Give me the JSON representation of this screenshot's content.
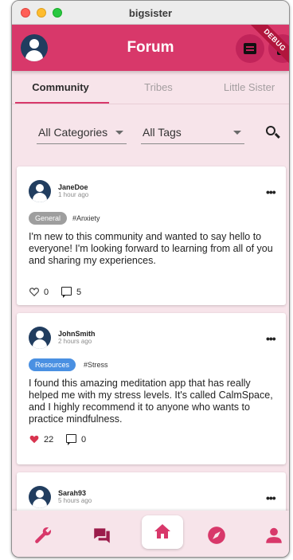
{
  "window": {
    "title": "bigsister"
  },
  "appbar": {
    "title": "Forum",
    "debug_banner": "DEBUG"
  },
  "tabs": [
    {
      "label": "Community",
      "active": true
    },
    {
      "label": "Tribes",
      "active": false
    },
    {
      "label": "Little Sister",
      "active": false
    }
  ],
  "filters": {
    "category": "All Categories",
    "tags": "All Tags"
  },
  "posts": [
    {
      "author": "JaneDoe",
      "time": "1 hour ago",
      "category": "General",
      "category_color": "#9e9e9e",
      "tag": "#Anxiety",
      "content": "I'm new to this community and wanted to say hello to everyone! I'm looking forward to learning from all of you and sharing my experiences.",
      "likes": "0",
      "liked": false,
      "comments": "5"
    },
    {
      "author": "JohnSmith",
      "time": "2 hours ago",
      "category": "Resources",
      "category_color": "#4a90e2",
      "tag": "#Stress",
      "content": "I found this amazing meditation app that has really helped me with my stress levels. It's called CalmSpace, and I highly recommend it to anyone who wants to practice mindfulness.",
      "likes": "22",
      "liked": true,
      "comments": "0"
    },
    {
      "author": "Sarah93",
      "time": "5 hours ago",
      "category_color": "#5cb85c"
    }
  ],
  "colors": {
    "primary": "#d8386a",
    "background": "#f7e4ea",
    "avatar": "#213d5f",
    "heart": "#d8344f"
  },
  "bottom_nav": [
    "wrench-icon",
    "chat-icon",
    "home-icon",
    "compass-icon",
    "person-icon"
  ]
}
